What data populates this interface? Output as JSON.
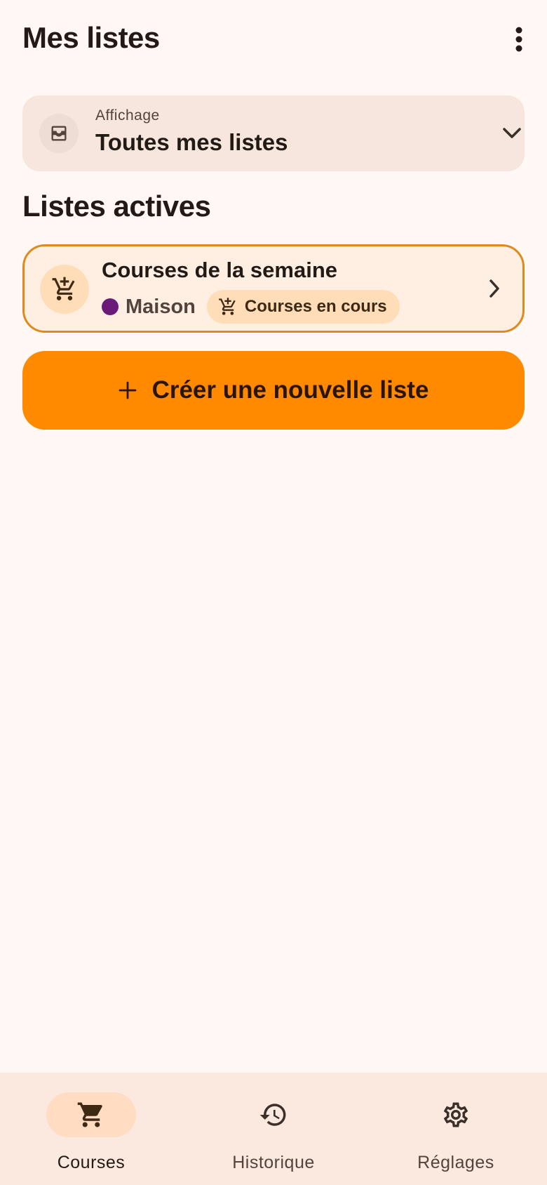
{
  "header": {
    "title": "Mes listes",
    "menu_icon": "more-vert-icon"
  },
  "filter": {
    "label": "Affichage",
    "value": "Toutes mes listes",
    "icon": "inbox-icon"
  },
  "active_section": {
    "title": "Listes actives"
  },
  "lists": [
    {
      "title": "Courses de la semaine",
      "group": "Maison",
      "group_color": "#6A1B7A",
      "status": "Courses en cours",
      "icon": "add-shopping-cart-icon"
    }
  ],
  "create_button": {
    "label": "Créer une nouvelle liste"
  },
  "nav": {
    "items": [
      {
        "label": "Courses",
        "icon": "shopping-cart-icon",
        "active": true
      },
      {
        "label": "Historique",
        "icon": "history-icon",
        "active": false
      },
      {
        "label": "Réglages",
        "icon": "settings-icon",
        "active": false
      }
    ]
  },
  "colors": {
    "background": "#FFF8F4",
    "accent": "#FF8A00",
    "card_border": "#E08A1E",
    "nav_background": "#FBE9E0"
  }
}
